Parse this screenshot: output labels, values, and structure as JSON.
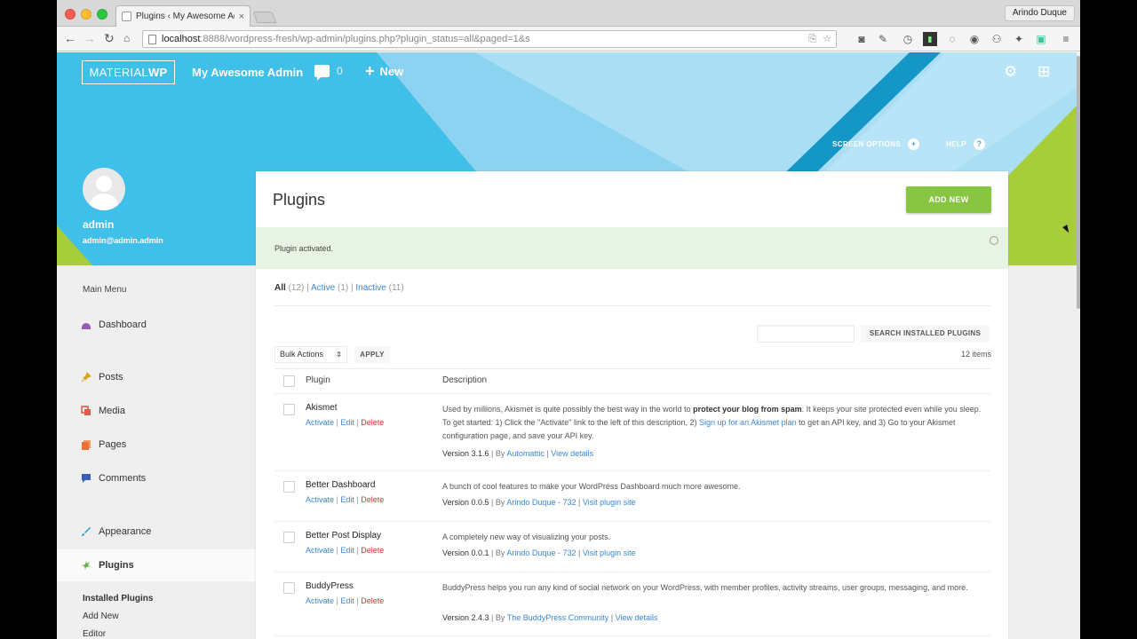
{
  "browser": {
    "tab_title": "Plugins ‹ My Awesome Adm",
    "tab_close": "×",
    "profile": "Arindo Duque",
    "url_host": "localhost",
    "url_path": ":8888/wordpress-fresh/wp-admin/plugins.php?plugin_status=all&paged=1&s"
  },
  "header": {
    "brand_light": "MATERIAL",
    "brand_bold": "WP",
    "site_name": "My Awesome Admin",
    "comments_count": "0",
    "new_label": "New",
    "screen_options": "SCREEN OPTIONS",
    "help": "HELP"
  },
  "user": {
    "name": "admin",
    "email": "admin@admin.admin"
  },
  "sidebar": {
    "title": "Main Menu",
    "items": [
      {
        "label": "Dashboard",
        "icon": "dashboard-icon",
        "color": "#9b59b6"
      },
      {
        "label": "Posts",
        "icon": "pin-icon",
        "color": "#d9a521"
      },
      {
        "label": "Media",
        "icon": "media-icon",
        "color": "#e05a47"
      },
      {
        "label": "Pages",
        "icon": "pages-icon",
        "color": "#e8713a"
      },
      {
        "label": "Comments",
        "icon": "comment-icon",
        "color": "#3b5db5"
      },
      {
        "label": "Appearance",
        "icon": "brush-icon",
        "color": "#1aa3c9"
      },
      {
        "label": "Plugins",
        "icon": "plugin-icon",
        "color": "#6ab04c"
      }
    ],
    "submenu": [
      "Installed Plugins",
      "Add New",
      "Editor"
    ]
  },
  "main": {
    "title": "Plugins",
    "add_new": "ADD NEW",
    "notice": "Plugin activated.",
    "filters": {
      "all": "All",
      "all_count": "(12)",
      "active": "Active",
      "active_count": "(1)",
      "inactive": "Inactive",
      "inactive_count": "(11)",
      "sep": "|"
    },
    "search_button": "SEARCH INSTALLED PLUGINS",
    "bulk_actions": "Bulk Actions",
    "bulk_arrow": "⇕",
    "apply": "APPLY",
    "item_count": "12 items",
    "col_plugin": "Plugin",
    "col_description": "Description",
    "row_actions": {
      "activate": "Activate",
      "edit": "Edit",
      "delete": "Delete",
      "sep": " | "
    },
    "plugins": [
      {
        "name": "Akismet",
        "desc_pre": "Used by millions, Akismet is quite possibly the best way in the world to ",
        "desc_bold": "protect your blog from spam",
        "desc_mid": ". It keeps your site protected even while you sleep. To get started: 1) Click the \"Activate\" link to the left of this description, 2) ",
        "desc_link": "Sign up for an Akismet plan",
        "desc_post": " to get an API key, and 3) Go to your Akismet configuration page, and save your API key.",
        "version": "Version 3.1.6",
        "by": " | By ",
        "author": "Automattic",
        "link": "View details"
      },
      {
        "name": "Better Dashboard",
        "desc": "A bunch of cool features to make your WordPress Dashboard much more awesome.",
        "version": "Version 0.0.5",
        "by": " | By ",
        "author": "Arindo Duque - 732",
        "link": "Visit plugin site"
      },
      {
        "name": "Better Post Display",
        "desc": "A completely new way of visualizing your posts.",
        "version": "Version 0.0.1",
        "by": " | By ",
        "author": "Arindo Duque - 732",
        "link": "Visit plugin site"
      },
      {
        "name": "BuddyPress",
        "desc": "BuddyPress helps you run any kind of social network on your WordPress, with member profiles, activity streams, user groups, messaging, and more.",
        "version": "Version 2.4.3",
        "by": " | By ",
        "author": "The BuddyPress Community",
        "link": "View details"
      }
    ]
  }
}
